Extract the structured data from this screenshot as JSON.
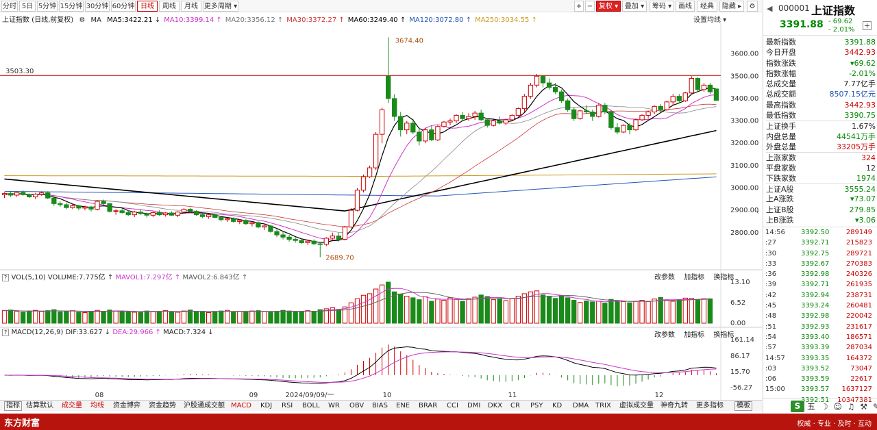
{
  "periods": [
    "分时",
    "5日",
    "5分钟",
    "15分钟",
    "30分钟",
    "60分钟",
    "日线",
    "周线",
    "月线",
    "更多周期 ▾"
  ],
  "active_period": "日线",
  "toolbar_right": {
    "plus": "+",
    "minus": "−",
    "fq": "复权 ▾",
    "overlay": "叠加 ▾",
    "chips": "筹码 ▾",
    "draw": "画线",
    "classic": "经典",
    "hide": "隐藏 ▸",
    "gear": "⚙"
  },
  "header": {
    "name": "上证指数 (日线,前复权)",
    "ma_label": "MA",
    "ma": [
      {
        "text": "MA5:3422.21 ↓",
        "color": "#000000"
      },
      {
        "text": "MA10:3399.14 ↑",
        "color": "#cc33cc"
      },
      {
        "text": "MA20:3356.12 ↑",
        "color": "#777777"
      },
      {
        "text": "MA30:3372.27 ↑",
        "color": "#cc3333"
      },
      {
        "text": "MA60:3249.40 ↑",
        "color": "#000000"
      },
      {
        "text": "MA120:3072.80 ↑",
        "color": "#2255bb"
      },
      {
        "text": "MA250:3034.55 ↑",
        "color": "#cc9922"
      }
    ],
    "setting": "设置均线 ▾"
  },
  "main_chart": {
    "hline_label": "3503.30",
    "high_label": "3674.40",
    "low_label": "2689.70",
    "y_ticks": [
      "3600.00",
      "3500.00",
      "3400.00",
      "3300.00",
      "3200.00",
      "3100.00",
      "3000.00",
      "2900.00",
      "2800.00"
    ]
  },
  "x_axis": {
    "labels": [
      "08",
      "09",
      "2024/09/09/一",
      "10",
      "11",
      "12"
    ]
  },
  "vol_panel": {
    "label": "VOL(5,10)",
    "volume": "VOLUME:7.775亿 ↑",
    "mavol1": "MAVOL1:7.297亿 ↑",
    "mavol2": "MAVOL2:6.843亿 ↑",
    "y_ticks": [
      "13.10",
      "6.52",
      "0.00"
    ]
  },
  "macd_panel": {
    "label": "MACD(12,26,9)",
    "dif": "DIF:33.627 ↓",
    "dea": "DEA:29.966 ↑",
    "macd": "MACD:7.324 ↓",
    "y_ticks": [
      "161.14",
      "86.17",
      "15.70",
      "-56.27"
    ]
  },
  "panel_actions": [
    "改参数",
    "加指标",
    "换指标"
  ],
  "indicator_tabs": [
    {
      "label": "指标",
      "style": "boxed"
    },
    {
      "label": "估算默认",
      "style": ""
    },
    {
      "label": "成交量",
      "style": "red"
    },
    {
      "label": "均线",
      "style": "red"
    },
    {
      "label": "资金博弈",
      "style": ""
    },
    {
      "label": "资金趋势",
      "style": ""
    },
    {
      "label": "沪股通成交额",
      "style": ""
    },
    {
      "label": "MACD",
      "style": "red"
    },
    {
      "label": "KDJ",
      "style": ""
    },
    {
      "label": "RSI",
      "style": ""
    },
    {
      "label": "BOLL",
      "style": ""
    },
    {
      "label": "WR",
      "style": ""
    },
    {
      "label": "OBV",
      "style": ""
    },
    {
      "label": "BIAS",
      "style": ""
    },
    {
      "label": "ENE",
      "style": ""
    },
    {
      "label": "BRAR",
      "style": ""
    },
    {
      "label": "CCI",
      "style": ""
    },
    {
      "label": "DMI",
      "style": ""
    },
    {
      "label": "DKX",
      "style": ""
    },
    {
      "label": "CR",
      "style": ""
    },
    {
      "label": "PSY",
      "style": ""
    },
    {
      "label": "KD",
      "style": ""
    },
    {
      "label": "DMA",
      "style": ""
    },
    {
      "label": "TRIX",
      "style": ""
    },
    {
      "label": "虚拟成交量",
      "style": ""
    },
    {
      "label": "神奇九转",
      "style": ""
    },
    {
      "label": "更多指标",
      "style": ""
    },
    {
      "label": "模板",
      "style": "boxed"
    }
  ],
  "brand": {
    "name": "东方财富",
    "slogan": "权威 · 专业 · 及时 · 互动"
  },
  "quote": {
    "code": "000001",
    "name": "上证指数",
    "price": "3391.88",
    "change": "- 69.62",
    "change_pct": "- 2.01%",
    "stats": [
      {
        "k": "最新指数",
        "v": "3391.88",
        "c": "#008800"
      },
      {
        "k": "今日开盘",
        "v": "3442.93",
        "c": "#cc0000"
      },
      {
        "k": "指数涨跌",
        "v": "▾69.62",
        "c": "#008800"
      },
      {
        "k": "指数涨幅",
        "v": "-2.01%",
        "c": "#008800"
      },
      {
        "k": "总成交量",
        "v": "7.77亿手",
        "c": "#222222"
      },
      {
        "k": "总成交额",
        "v": "8507.15亿元",
        "c": "#2255bb"
      },
      {
        "k": "最高指数",
        "v": "3442.93",
        "c": "#cc0000"
      },
      {
        "k": "最低指数",
        "v": "3390.75",
        "c": "#008800"
      },
      {
        "k": "上证换手",
        "v": "1.67%",
        "c": "#222222",
        "sep": true
      },
      {
        "k": "内盘总量",
        "v": "44541万手",
        "c": "#008800"
      },
      {
        "k": "外盘总量",
        "v": "33205万手",
        "c": "#cc0000"
      },
      {
        "k": "上涨家数",
        "v": "324",
        "c": "#cc0000",
        "sep": true
      },
      {
        "k": "平盘家数",
        "v": "12",
        "c": "#222222"
      },
      {
        "k": "下跌家数",
        "v": "1974",
        "c": "#008800"
      },
      {
        "k": "上证A股",
        "v": "3555.24",
        "c": "#008800",
        "sep": true
      },
      {
        "k": "上A涨跌",
        "v": "▾73.07",
        "c": "#008800"
      },
      {
        "k": "上证B股",
        "v": "279.85",
        "c": "#008800"
      },
      {
        "k": "上B涨跌",
        "v": "▾3.06",
        "c": "#008800"
      }
    ],
    "ticks": [
      {
        "t": "14:56",
        "p": "3392.50",
        "q": "289149"
      },
      {
        "t": ":27",
        "p": "3392.71",
        "q": "215823"
      },
      {
        "t": ":30",
        "p": "3392.75",
        "q": "289721"
      },
      {
        "t": ":33",
        "p": "3392.67",
        "q": "270383"
      },
      {
        "t": ":36",
        "p": "3392.98",
        "q": "240326"
      },
      {
        "t": ":39",
        "p": "3392.71",
        "q": "261935"
      },
      {
        "t": ":42",
        "p": "3392.94",
        "q": "238731"
      },
      {
        "t": ":45",
        "p": "3393.24",
        "q": "260481"
      },
      {
        "t": ":48",
        "p": "3392.98",
        "q": "220042"
      },
      {
        "t": ":51",
        "p": "3392.93",
        "q": "231617"
      },
      {
        "t": ":54",
        "p": "3393.40",
        "q": "186571"
      },
      {
        "t": ":57",
        "p": "3393.39",
        "q": "287034"
      },
      {
        "t": "14:57",
        "p": "3393.35",
        "q": "164372"
      },
      {
        "t": ":03",
        "p": "3393.52",
        "q": "73047"
      },
      {
        "t": ":06",
        "p": "3393.59",
        "q": "22617"
      },
      {
        "t": "15:00",
        "p": "3393.57",
        "q": "1637127"
      },
      {
        "t": "",
        "p": "3392.51",
        "q": "10347381"
      }
    ],
    "foot_logo": "S",
    "foot_icons": "五 ☽ ☺ ♫ ⚒ ✎"
  },
  "chart_data": {
    "type": "candlestick",
    "title": "上证指数 (日线,前复权)",
    "ylim": [
      2640,
      3700
    ],
    "reference_line": 3503.3,
    "candles": [
      [
        2970,
        2980,
        2955,
        2975
      ],
      [
        2975,
        2982,
        2960,
        2968
      ],
      [
        2968,
        2985,
        2960,
        2980
      ],
      [
        2980,
        2990,
        2965,
        2970
      ],
      [
        2970,
        2975,
        2955,
        2960
      ],
      [
        2960,
        2978,
        2950,
        2972
      ],
      [
        2972,
        2985,
        2965,
        2978
      ],
      [
        2978,
        2985,
        2950,
        2955
      ],
      [
        2955,
        2962,
        2920,
        2930
      ],
      [
        2930,
        2940,
        2915,
        2925
      ],
      [
        2925,
        2935,
        2905,
        2912
      ],
      [
        2912,
        2928,
        2905,
        2920
      ],
      [
        2920,
        2925,
        2900,
        2910
      ],
      [
        2910,
        2920,
        2900,
        2915
      ],
      [
        2915,
        2920,
        2895,
        2905
      ],
      [
        2905,
        2945,
        2900,
        2940
      ],
      [
        2940,
        2948,
        2925,
        2930
      ],
      [
        2930,
        2932,
        2890,
        2895
      ],
      [
        2895,
        2905,
        2880,
        2898
      ],
      [
        2898,
        2908,
        2885,
        2890
      ],
      [
        2890,
        2900,
        2875,
        2880
      ],
      [
        2880,
        2898,
        2870,
        2892
      ],
      [
        2892,
        2905,
        2880,
        2885
      ],
      [
        2885,
        2890,
        2868,
        2878
      ],
      [
        2878,
        2895,
        2870,
        2890
      ],
      [
        2890,
        2900,
        2875,
        2880
      ],
      [
        2880,
        2892,
        2872,
        2888
      ],
      [
        2888,
        2895,
        2875,
        2878
      ],
      [
        2878,
        2895,
        2870,
        2892
      ],
      [
        2892,
        2910,
        2885,
        2905
      ],
      [
        2905,
        2912,
        2890,
        2895
      ],
      [
        2895,
        2900,
        2875,
        2880
      ],
      [
        2880,
        2888,
        2865,
        2872
      ],
      [
        2872,
        2885,
        2862,
        2880
      ],
      [
        2880,
        2885,
        2865,
        2868
      ],
      [
        2868,
        2872,
        2850,
        2858
      ],
      [
        2858,
        2868,
        2848,
        2862
      ],
      [
        2862,
        2868,
        2845,
        2850
      ],
      [
        2850,
        2860,
        2838,
        2855
      ],
      [
        2855,
        2860,
        2835,
        2840
      ],
      [
        2840,
        2850,
        2828,
        2845
      ],
      [
        2845,
        2850,
        2820,
        2825
      ],
      [
        2825,
        2835,
        2812,
        2830
      ],
      [
        2830,
        2835,
        2800,
        2805
      ],
      [
        2805,
        2815,
        2780,
        2790
      ],
      [
        2790,
        2805,
        2770,
        2780
      ],
      [
        2780,
        2790,
        2760,
        2770
      ],
      [
        2770,
        2780,
        2755,
        2765
      ],
      [
        2765,
        2775,
        2750,
        2755
      ],
      [
        2755,
        2768,
        2745,
        2762
      ],
      [
        2762,
        2770,
        2745,
        2750
      ],
      [
        2750,
        2758,
        2690,
        2748
      ],
      [
        2748,
        2780,
        2740,
        2775
      ],
      [
        2775,
        2800,
        2770,
        2785
      ],
      [
        2785,
        2800,
        2760,
        2770
      ],
      [
        2770,
        2830,
        2765,
        2825
      ],
      [
        2825,
        2910,
        2820,
        2900
      ],
      [
        2900,
        3000,
        2895,
        2990
      ],
      [
        2990,
        3060,
        2980,
        3050
      ],
      [
        3050,
        3100,
        3045,
        3090
      ],
      [
        3090,
        3250,
        3080,
        3240
      ],
      [
        3240,
        3360,
        3200,
        3350
      ],
      [
        3500,
        3674,
        3380,
        3400
      ],
      [
        3400,
        3420,
        3300,
        3320
      ],
      [
        3320,
        3340,
        3230,
        3260
      ],
      [
        3260,
        3300,
        3240,
        3290
      ],
      [
        3290,
        3310,
        3240,
        3250
      ],
      [
        3250,
        3270,
        3190,
        3210
      ],
      [
        3210,
        3270,
        3200,
        3260
      ],
      [
        3260,
        3280,
        3210,
        3215
      ],
      [
        3215,
        3280,
        3210,
        3275
      ],
      [
        3275,
        3300,
        3270,
        3295
      ],
      [
        3295,
        3310,
        3280,
        3300
      ],
      [
        3300,
        3330,
        3290,
        3325
      ],
      [
        3325,
        3340,
        3300,
        3310
      ],
      [
        3310,
        3335,
        3300,
        3320
      ],
      [
        3320,
        3345,
        3305,
        3335
      ],
      [
        3335,
        3350,
        3300,
        3305
      ],
      [
        3305,
        3310,
        3270,
        3280
      ],
      [
        3280,
        3305,
        3275,
        3300
      ],
      [
        3300,
        3320,
        3285,
        3290
      ],
      [
        3290,
        3310,
        3280,
        3305
      ],
      [
        3305,
        3330,
        3300,
        3325
      ],
      [
        3325,
        3360,
        3320,
        3355
      ],
      [
        3355,
        3420,
        3340,
        3410
      ],
      [
        3410,
        3470,
        3400,
        3460
      ],
      [
        3460,
        3510,
        3450,
        3500
      ],
      [
        3500,
        3505,
        3450,
        3470
      ],
      [
        3470,
        3490,
        3440,
        3450
      ],
      [
        3450,
        3470,
        3420,
        3430
      ],
      [
        3430,
        3440,
        3380,
        3390
      ],
      [
        3390,
        3400,
        3340,
        3350
      ],
      [
        3350,
        3360,
        3300,
        3310
      ],
      [
        3310,
        3350,
        3305,
        3345
      ],
      [
        3345,
        3370,
        3330,
        3340
      ],
      [
        3340,
        3350,
        3300,
        3320
      ],
      [
        3320,
        3380,
        3315,
        3370
      ],
      [
        3370,
        3380,
        3330,
        3340
      ],
      [
        3340,
        3350,
        3260,
        3270
      ],
      [
        3270,
        3290,
        3240,
        3250
      ],
      [
        3250,
        3285,
        3245,
        3280
      ],
      [
        3280,
        3290,
        3240,
        3260
      ],
      [
        3260,
        3310,
        3255,
        3305
      ],
      [
        3305,
        3330,
        3300,
        3325
      ],
      [
        3325,
        3345,
        3310,
        3340
      ],
      [
        3340,
        3370,
        3330,
        3365
      ],
      [
        3365,
        3375,
        3340,
        3350
      ],
      [
        3350,
        3390,
        3345,
        3385
      ],
      [
        3385,
        3420,
        3370,
        3410
      ],
      [
        3410,
        3420,
        3380,
        3390
      ],
      [
        3390,
        3430,
        3385,
        3425
      ],
      [
        3425,
        3500,
        3420,
        3490
      ],
      [
        3490,
        3495,
        3430,
        3440
      ],
      [
        3440,
        3470,
        3430,
        3460
      ],
      [
        3460,
        3470,
        3420,
        3430
      ],
      [
        3442.93,
        3442.93,
        3390.75,
        3391.88
      ]
    ],
    "volume": [
      4.0,
      4.2,
      3.8,
      3.5,
      3.9,
      4.1,
      3.7,
      4.0,
      4.3,
      3.6,
      3.8,
      4.0,
      3.5,
      3.4,
      3.7,
      4.1,
      3.8,
      4.2,
      3.9,
      3.6,
      3.7,
      3.5,
      3.4,
      3.9,
      3.6,
      3.8,
      4.0,
      3.7,
      3.5,
      3.9,
      4.2,
      3.8,
      3.6,
      3.4,
      3.7,
      3.9,
      4.1,
      3.5,
      3.8,
      3.6,
      3.9,
      4.0,
      3.7,
      3.5,
      3.8,
      4.1,
      3.9,
      3.6,
      3.7,
      4.0,
      3.8,
      4.3,
      4.6,
      4.9,
      4.4,
      5.2,
      6.5,
      7.8,
      8.9,
      9.4,
      10.9,
      12.2,
      13.1,
      10.0,
      9.3,
      8.6,
      8.1,
      7.5,
      8.4,
      7.0,
      7.7,
      7.3,
      8.1,
      7.6,
      7.0,
      7.8,
      8.3,
      9.0,
      8.5,
      7.5,
      7.8,
      7.2,
      7.9,
      8.6,
      9.4,
      10.0,
      10.3,
      9.0,
      8.4,
      7.9,
      8.8,
      8.1,
      7.3,
      6.6,
      7.1,
      6.8,
      7.0,
      6.4,
      7.6,
      7.2,
      6.9,
      6.5,
      7.0,
      7.3,
      6.9,
      7.7,
      8.2,
      7.4,
      7.0,
      7.5,
      8.0,
      7.9,
      7.6,
      7.8,
      7.775
    ],
    "mavol1": 7.297,
    "mavol2": 6.843,
    "vol_ylim": [
      0,
      13.1
    ],
    "macd_ylim": [
      -56.27,
      161.14
    ],
    "dif": 33.627,
    "dea": 29.966,
    "macd": 7.324
  }
}
